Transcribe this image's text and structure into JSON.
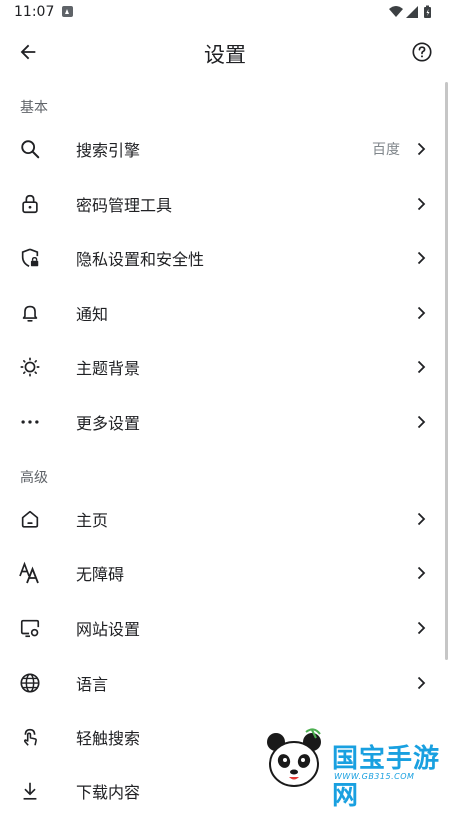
{
  "status_bar": {
    "time": "11:07"
  },
  "header": {
    "title": "设置"
  },
  "sections": [
    {
      "title": "基本",
      "items": [
        {
          "label": "搜索引擎",
          "value": "百度",
          "icon": "search-icon"
        },
        {
          "label": "密码管理工具",
          "icon": "lock-icon"
        },
        {
          "label": "隐私设置和安全性",
          "icon": "shield-lock-icon"
        },
        {
          "label": "通知",
          "icon": "bell-icon"
        },
        {
          "label": "主题背景",
          "icon": "brightness-icon"
        },
        {
          "label": "更多设置",
          "icon": "more-horiz-icon"
        }
      ]
    },
    {
      "title": "高级",
      "items": [
        {
          "label": "主页",
          "icon": "home-icon"
        },
        {
          "label": "无障碍",
          "icon": "text-size-icon"
        },
        {
          "label": "网站设置",
          "icon": "site-settings-icon"
        },
        {
          "label": "语言",
          "icon": "globe-icon"
        },
        {
          "label": "轻触搜索",
          "icon": "touch-search-icon"
        },
        {
          "label": "下载内容",
          "icon": "download-icon"
        }
      ]
    }
  ],
  "watermark": {
    "title": "国宝手游网",
    "subtitle": "WWW.GB315.COM"
  },
  "colors": {
    "text": "#202124",
    "secondary": "#5f6368",
    "accent": "#19a0e0"
  }
}
